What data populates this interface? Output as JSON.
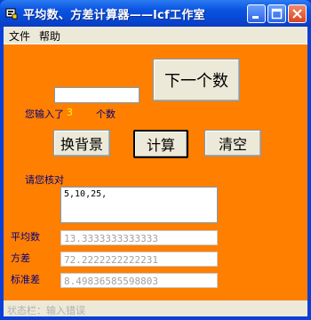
{
  "window": {
    "title": "平均数、方差计算器——lcf工作室"
  },
  "menu": [
    "文件",
    "帮助"
  ],
  "controls": {
    "next_button": "下一个数",
    "input_value": "",
    "count_prefix": "您输入了",
    "count_value": "3",
    "count_suffix": "个数",
    "change_bg_button": "换背景",
    "calculate_button": "计算",
    "clear_button": "清空",
    "check_label": "请您核对",
    "numbers_list": "5,10,25,"
  },
  "results": {
    "mean_label": "平均数",
    "mean_value": "13.3333333333333",
    "variance_label": "方差",
    "variance_value": "72.2222222222231",
    "stddev_label": "标准差",
    "stddev_value": " 8.49836585598803"
  },
  "status": {
    "text": "状态栏：输入错误"
  },
  "colors": {
    "background": "#ff7f00",
    "count_value": "#ffff00",
    "label_text": "#000080"
  }
}
